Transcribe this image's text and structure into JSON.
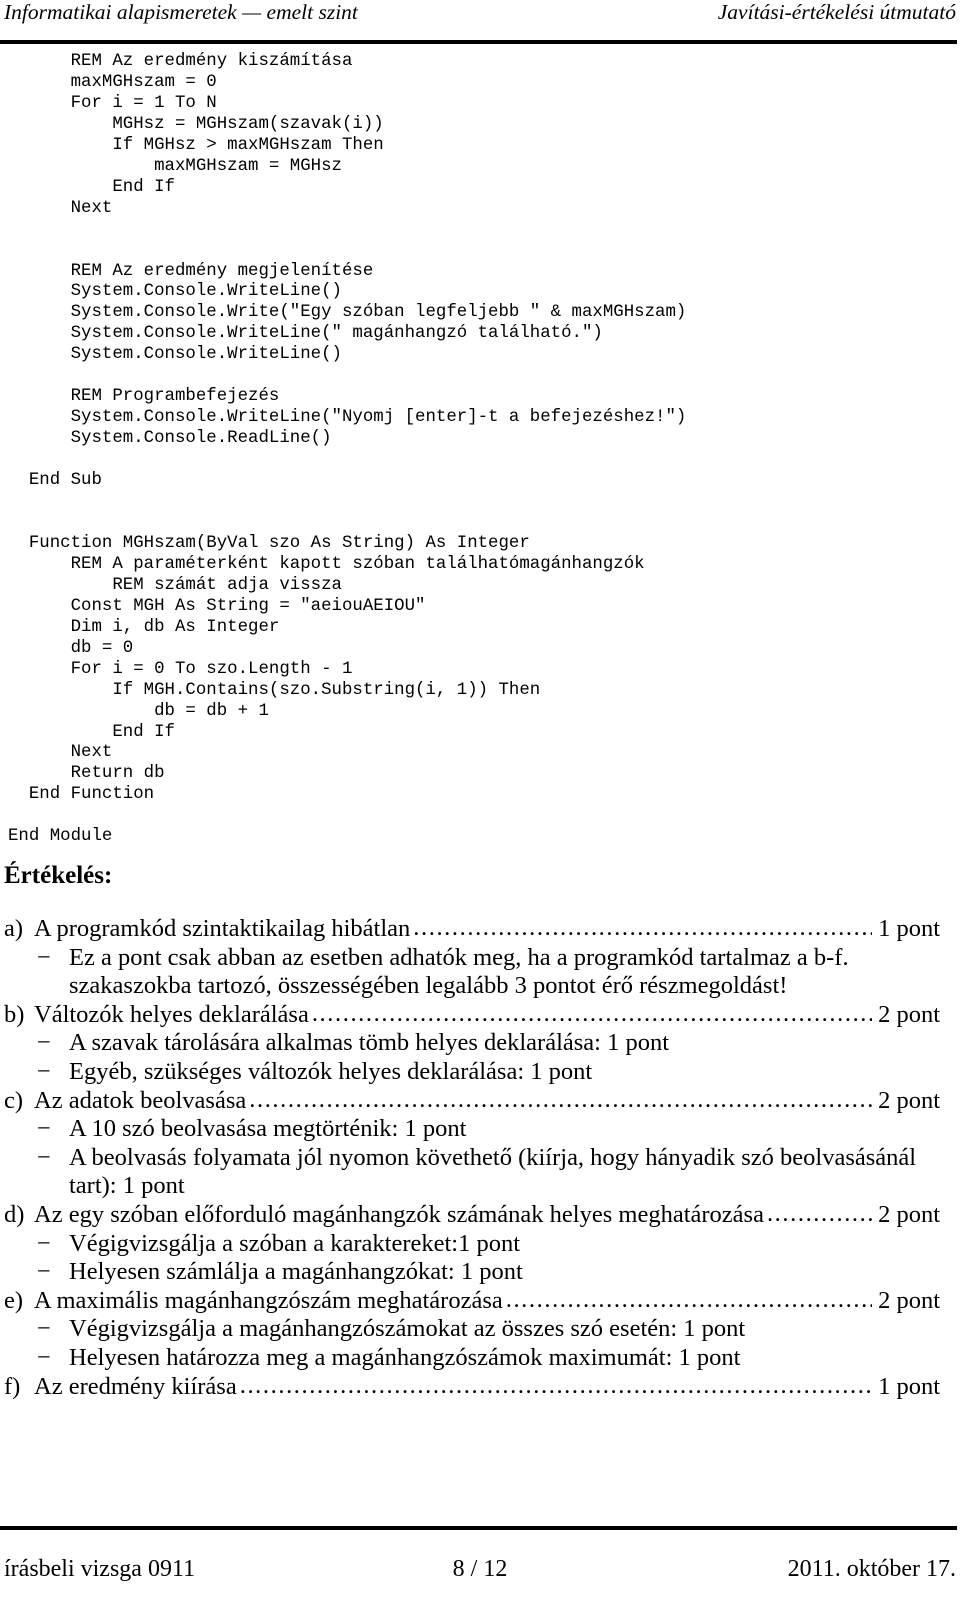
{
  "header": {
    "left": "Informatikai alapismeretek — emelt szint",
    "right": "Javítási-értékelési útmutató"
  },
  "code": {
    "language": "Visual Basic .NET",
    "lines": [
      "      REM Az eredmény kiszámítása",
      "      maxMGHszam = 0",
      "      For i = 1 To N",
      "          MGHsz = MGHszam(szavak(i))",
      "          If MGHsz > maxMGHszam Then",
      "              maxMGHszam = MGHsz",
      "          End If",
      "      Next",
      "",
      "",
      "      REM Az eredmény megjelenítése",
      "      System.Console.WriteLine()",
      "      System.Console.Write(\"Egy szóban legfeljebb \" & maxMGHszam)",
      "      System.Console.WriteLine(\" magánhangzó található.\")",
      "      System.Console.WriteLine()",
      "",
      "      REM Programbefejezés",
      "      System.Console.WriteLine(\"Nyomj [enter]-t a befejezéshez!\")",
      "      System.Console.ReadLine()",
      "",
      "  End Sub",
      "",
      "",
      "  Function MGHszam(ByVal szo As String) As Integer",
      "      REM A paraméterként kapott szóban találhatómagánhangzók",
      "          REM számát adja vissza",
      "      Const MGH As String = \"aeiouAEIOU\"",
      "      Dim i, db As Integer",
      "      db = 0",
      "      For i = 0 To szo.Length - 1",
      "          If MGH.Contains(szo.Substring(i, 1)) Then",
      "              db = db + 1",
      "          End If",
      "      Next",
      "      Return db",
      "  End Function",
      "",
      "End Module"
    ]
  },
  "evaluation": {
    "heading": "Értékelés:",
    "leader_dots": "......................................................................................................................................................",
    "dash": "−",
    "items": [
      {
        "label": "a)",
        "text": "A programkód szintaktikailag hibátlan",
        "points": "1 pont",
        "subs": [
          {
            "line1": "Ez a pont csak abban az esetben adhatók meg, ha a programkód tartalmaz a b-f.",
            "line2": "szakaszokba tartozó, összességében legalább 3 pontot érő részmegoldást!"
          }
        ]
      },
      {
        "label": "b)",
        "text": "Változók helyes deklarálása",
        "points": "2 pont",
        "subs": [
          {
            "line1": "A szavak tárolására alkalmas tömb helyes deklarálása: 1 pont",
            "line2": ""
          },
          {
            "line1": "Egyéb, szükséges változók helyes deklarálása: 1 pont",
            "line2": ""
          }
        ]
      },
      {
        "label": "c)",
        "text": "Az adatok beolvasása",
        "points": "2 pont",
        "subs": [
          {
            "line1": "A 10 szó beolvasása megtörténik: 1 pont",
            "line2": ""
          },
          {
            "line1": "A beolvasás folyamata jól nyomon követhető (kiírja, hogy hányadik szó beolvasásánál",
            "line2": "tart): 1 pont"
          }
        ]
      },
      {
        "label": "d)",
        "text": "Az egy szóban előforduló magánhangzók számának helyes meghatározása",
        "points": "2 pont",
        "subs": [
          {
            "line1": "Végigvizsgálja a szóban a karaktereket:1 pont",
            "line2": ""
          },
          {
            "line1": "Helyesen számlálja a magánhangzókat: 1 pont",
            "line2": ""
          }
        ]
      },
      {
        "label": "e)",
        "text": "A maximális magánhangzószám meghatározása",
        "points": "2 pont",
        "subs": [
          {
            "line1": "Végigvizsgálja a magánhangzószámokat az összes szó esetén: 1 pont",
            "line2": ""
          },
          {
            "line1": "Helyesen határozza meg a magánhangzószámok maximumát: 1 pont",
            "line2": ""
          }
        ]
      },
      {
        "label": "f)",
        "text": "Az eredmény kiírása",
        "points": "1 pont",
        "subs": []
      }
    ]
  },
  "footer": {
    "left": "írásbeli vizsga 0911",
    "center": "8 / 12",
    "right": "2011. október 17."
  }
}
